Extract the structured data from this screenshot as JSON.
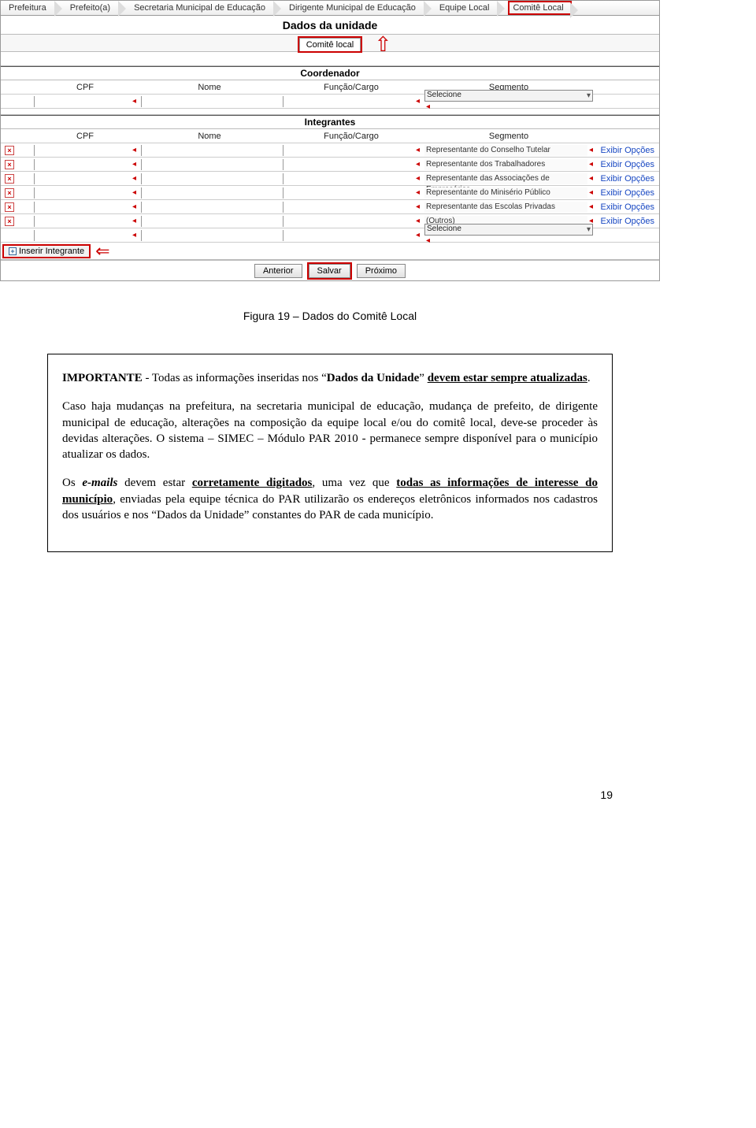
{
  "breadcrumb": [
    "Prefeitura",
    "Prefeito(a)",
    "Secretaria Municipal de Educação",
    "Dirigente Municipal de Educação",
    "Equipe Local",
    "Comitê Local"
  ],
  "section_title": "Dados da unidade",
  "subtab": "Comitê local",
  "coord": {
    "title": "Coordenador",
    "headers": [
      "CPF",
      "Nome",
      "Função/Cargo",
      "Segmento"
    ],
    "select_placeholder": "Selecione"
  },
  "integ": {
    "title": "Integrantes",
    "headers": [
      "CPF",
      "Nome",
      "Função/Cargo",
      "Segmento"
    ],
    "rows": [
      "Representante do Conselho Tutelar",
      "Representante dos Trabalhadores",
      "Representante das Associações de Empresários",
      "Representante do Minisério Público",
      "Representante das Escolas Privadas",
      "(Outros)"
    ],
    "opts_label": "Exibir Opções",
    "select_placeholder": "Selecione",
    "insert_label": "Inserir Integrante"
  },
  "buttons": {
    "prev": "Anterior",
    "save": "Salvar",
    "next": "Próximo"
  },
  "figure_caption": "Figura 19 – Dados do Comitê Local",
  "note": {
    "p1a": "IMPORTANTE",
    "p1b": " - Todas as informações inseridas nos “",
    "p1c": "Dados da Unidade",
    "p1d": "” ",
    "p1e": "devem estar sempre atualizadas",
    "p1f": ".",
    "p2": "Caso haja mudanças na prefeitura, na secretaria municipal de educação, mudança de prefeito, de dirigente municipal de educação, alterações na composição da equipe local e/ou do comitê local, deve-se proceder às devidas alterações. O sistema – SIMEC – Módulo PAR 2010 - permanece sempre disponível para o município atualizar os dados.",
    "p3a": "Os ",
    "p3b": "e-mails",
    "p3c": " devem estar ",
    "p3d": "corretamente digitados",
    "p3e": ", uma vez que ",
    "p3f": "todas as informações de interesse do município",
    "p3g": ", enviadas pela equipe técnica do PAR utilizarão os endereços eletrônicos informados nos cadastros dos usuários e nos “Dados da Unidade” constantes do PAR de cada município."
  },
  "page_number": "19"
}
